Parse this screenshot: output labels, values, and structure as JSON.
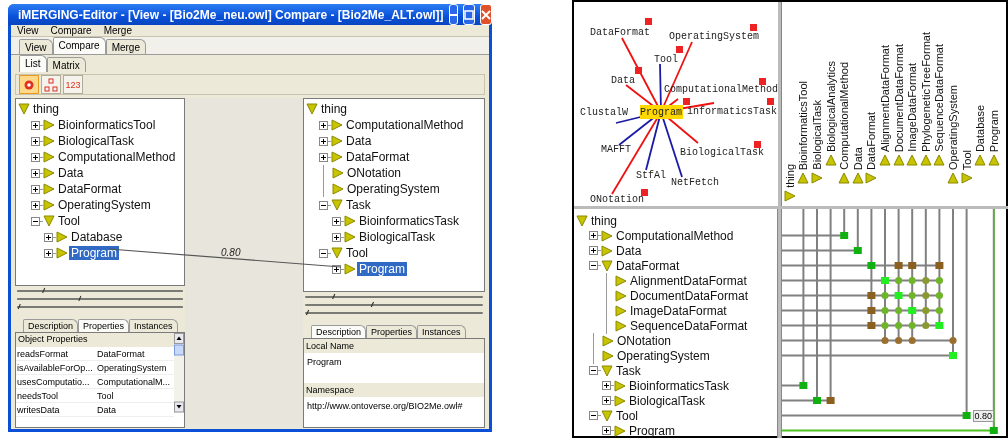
{
  "left_window": {
    "title": "iMERGING-Editor - [View - [Bio2Me_neu.owl] Compare - [Bio2Me_ALT.owl]]",
    "menu": [
      "View",
      "Compare",
      "Merge"
    ],
    "tabs": [
      {
        "label": "View",
        "selected": false
      },
      {
        "label": "Compare",
        "selected": true
      },
      {
        "label": "Merge",
        "selected": false
      }
    ],
    "subtabs": [
      {
        "label": "List",
        "selected": true
      },
      {
        "label": "Matrix",
        "selected": false
      }
    ],
    "toolbar": [
      {
        "kind": "circle",
        "selected": true
      },
      {
        "kind": "nodes",
        "selected": false
      },
      {
        "kind": "text",
        "label": "123",
        "selected": false
      }
    ],
    "left_tree": [
      {
        "label": "thing",
        "expanded": true,
        "selected": false,
        "children": [
          {
            "label": "BioinformaticsTool",
            "expandable": true,
            "expanded": false,
            "selected": false
          },
          {
            "label": "BiologicalTask",
            "expandable": true,
            "expanded": false,
            "selected": false
          },
          {
            "label": "ComputationalMethod",
            "expandable": true,
            "expanded": false,
            "selected": false
          },
          {
            "label": "Data",
            "expandable": true,
            "expanded": false,
            "selected": false
          },
          {
            "label": "DataFormat",
            "expandable": true,
            "expanded": false,
            "selected": false
          },
          {
            "label": "OperatingSystem",
            "expandable": true,
            "expanded": false,
            "selected": false
          },
          {
            "label": "Tool",
            "expandable": true,
            "expanded": true,
            "selected": false,
            "children": [
              {
                "label": "Database",
                "expandable": true,
                "expanded": false,
                "selected": false
              },
              {
                "label": "Program",
                "expandable": true,
                "expanded": false,
                "selected": true
              }
            ]
          }
        ]
      }
    ],
    "right_tree": [
      {
        "label": "thing",
        "expanded": true,
        "selected": false,
        "children": [
          {
            "label": "ComputationalMethod",
            "expandable": true,
            "expanded": false,
            "selected": false
          },
          {
            "label": "Data",
            "expandable": true,
            "expanded": false,
            "selected": false
          },
          {
            "label": "DataFormat",
            "expandable": true,
            "expanded": false,
            "selected": false
          },
          {
            "label": "ONotation",
            "expandable": false,
            "expanded": false,
            "selected": false
          },
          {
            "label": "OperatingSystem",
            "expandable": false,
            "expanded": false,
            "selected": false
          },
          {
            "label": "Task",
            "expandable": true,
            "expanded": true,
            "selected": false,
            "children": [
              {
                "label": "BioinformaticsTask",
                "expandable": true,
                "expanded": false,
                "selected": false
              },
              {
                "label": "BiologicalTask",
                "expandable": true,
                "expanded": false,
                "selected": false
              }
            ]
          },
          {
            "label": "Tool",
            "expandable": true,
            "expanded": true,
            "selected": false,
            "children": [
              {
                "label": "Program",
                "expandable": true,
                "expanded": false,
                "selected": true
              }
            ]
          }
        ]
      }
    ],
    "mapping": {
      "score": "0.80"
    },
    "left_details": {
      "tabs": [
        {
          "label": "Description",
          "selected": false
        },
        {
          "label": "Properties",
          "selected": true
        },
        {
          "label": "Instances",
          "selected": false
        }
      ],
      "table": {
        "header": "Object Properties",
        "rows": [
          [
            "readsFormat",
            "DataFormat"
          ],
          [
            "isAvailableForOp...",
            "OperatingSystem"
          ],
          [
            "usesComputatio...",
            "ComputationalM..."
          ],
          [
            "needsTool",
            "Tool"
          ],
          [
            "writesData",
            "Data"
          ]
        ]
      }
    },
    "right_details": {
      "tabs": [
        {
          "label": "Description",
          "selected": true
        },
        {
          "label": "Properties",
          "selected": false
        },
        {
          "label": "Instances",
          "selected": false
        }
      ],
      "fields": [
        {
          "label": "Local Name",
          "value": "Program"
        },
        {
          "label": "Namespace",
          "value": "http://www.ontoverse.org/BIO2Me.owl#"
        }
      ]
    }
  },
  "right_panel": {
    "graph": {
      "center": {
        "label": "Program",
        "badge": true
      },
      "nodes": [
        {
          "label": "DataFormat",
          "color": "#ee1111",
          "badge": true
        },
        {
          "label": "OperatingSystem",
          "color": "#ee1111",
          "badge": true
        },
        {
          "label": "Tool",
          "color": "#1a1aa6",
          "badge": true
        },
        {
          "label": "Data",
          "color": "#ee1111",
          "badge": true
        },
        {
          "label": "ComputationalMethod",
          "color": "#ee1111",
          "badge": true
        },
        {
          "label": "ClustalW",
          "color": "#1a1aa6",
          "badge": false
        },
        {
          "label": "informaticsTask",
          "color": "#ee1111",
          "badge": true
        },
        {
          "label": "MAFFT",
          "color": "#1a1aa6",
          "badge": false
        },
        {
          "label": "BiologicalTask",
          "color": "#ee1111",
          "badge": true
        },
        {
          "label": "StfAl",
          "color": "#1a1aa6",
          "badge": false
        },
        {
          "label": "NetFetch",
          "color": "#1a1aa6",
          "badge": false
        },
        {
          "label": "ONotation",
          "color": "#ee1111",
          "badge": true
        }
      ]
    },
    "matrix_columns": [
      {
        "label": "thing",
        "expanded": true,
        "children": [
          {
            "label": "BioinformaticsTool",
            "expanded": false
          },
          {
            "label": "BiologicalTask",
            "expanded": true,
            "children": [
              {
                "label": "BiologicalAnalytics",
                "expanded": false
              }
            ]
          },
          {
            "label": "ComputationalMethod",
            "expanded": false
          },
          {
            "label": "Data",
            "expanded": false
          },
          {
            "label": "DataFormat",
            "expanded": true,
            "children": [
              {
                "label": "AlignmentDataFormat",
                "expanded": false
              },
              {
                "label": "DocumentDataFormat",
                "expanded": false
              },
              {
                "label": "ImageDataFormat",
                "expanded": false
              },
              {
                "label": "PhylogeneticTreeFormat",
                "expanded": false
              },
              {
                "label": "SequenceDataFormat",
                "expanded": false
              }
            ]
          },
          {
            "label": "OperatingSystem",
            "expanded": false
          },
          {
            "label": "Tool",
            "expanded": true,
            "children": [
              {
                "label": "Database",
                "expanded": false
              },
              {
                "label": "Program",
                "expanded": false
              }
            ]
          }
        ]
      }
    ],
    "tree": [
      {
        "label": "thing",
        "expanded": true,
        "selected": false,
        "children": [
          {
            "label": "ComputationalMethod",
            "expandable": true,
            "expanded": false,
            "selected": false
          },
          {
            "label": "Data",
            "expandable": true,
            "expanded": false,
            "selected": false
          },
          {
            "label": "DataFormat",
            "expandable": true,
            "expanded": true,
            "selected": false,
            "children": [
              {
                "label": "AlignmentDataFormat",
                "expandable": false,
                "expanded": false,
                "selected": false
              },
              {
                "label": "DocumentDataFormat",
                "expandable": false,
                "expanded": false,
                "selected": false
              },
              {
                "label": "ImageDataFormat",
                "expandable": false,
                "expanded": false,
                "selected": false
              },
              {
                "label": "SequenceDataFormat",
                "expandable": false,
                "expanded": false,
                "selected": false
              }
            ]
          },
          {
            "label": "ONotation",
            "expandable": false,
            "expanded": false,
            "selected": false
          },
          {
            "label": "OperatingSystem",
            "expandable": false,
            "expanded": false,
            "selected": false
          },
          {
            "label": "Task",
            "expandable": true,
            "expanded": true,
            "selected": false,
            "children": [
              {
                "label": "BioinformaticsTask",
                "expandable": true,
                "expanded": false,
                "selected": false
              },
              {
                "label": "BiologicalTask",
                "expandable": true,
                "expanded": false,
                "selected": false
              }
            ]
          },
          {
            "label": "Tool",
            "expandable": true,
            "expanded": true,
            "selected": false,
            "children": [
              {
                "label": "Program",
                "expandable": true,
                "expanded": false,
                "selected": false
              }
            ]
          }
        ]
      }
    ],
    "matrix_score": "0.80"
  }
}
